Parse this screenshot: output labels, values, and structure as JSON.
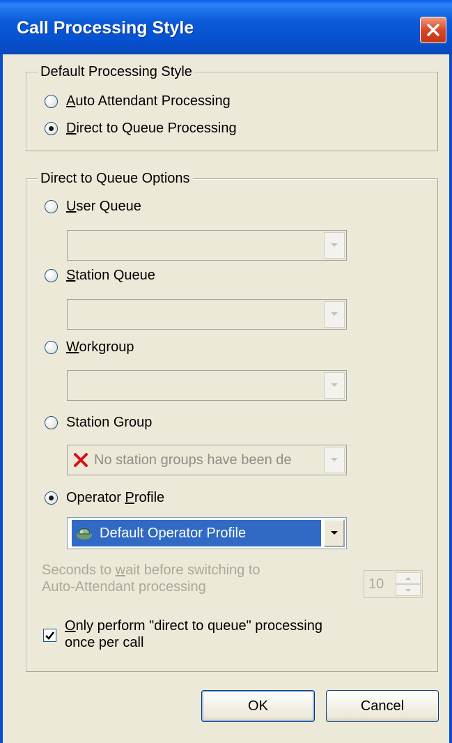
{
  "window": {
    "title": "Call Processing Style"
  },
  "default_style": {
    "legend": "Default Processing Style",
    "options": [
      {
        "pre": "",
        "key": "A",
        "post": "uto Attendant Processing",
        "checked": false
      },
      {
        "pre": "",
        "key": "D",
        "post": "irect to Queue Processing",
        "checked": true
      }
    ]
  },
  "queue_options": {
    "legend": "Direct to Queue Options",
    "user_queue": {
      "pre": "",
      "key": "U",
      "post": "ser Queue",
      "checked": false,
      "value": ""
    },
    "station_queue": {
      "pre": "",
      "key": "S",
      "post": "tation Queue",
      "checked": false,
      "value": ""
    },
    "workgroup": {
      "pre": "",
      "key": "W",
      "post": "orkgroup",
      "checked": false,
      "value": ""
    },
    "station_group": {
      "label": "Station Group",
      "checked": false,
      "value": "No station groups have been de",
      "icon": "error-x-icon"
    },
    "operator_profile": {
      "pre": "Operator ",
      "key": "P",
      "post": "rofile",
      "checked": true,
      "value": "Default Operator Profile",
      "icon": "operator-profile-icon"
    },
    "seconds": {
      "line1_pre": "Seconds to ",
      "line1_key": "w",
      "line1_post": "ait before switching to",
      "line2": "Auto-Attendant processing",
      "value": "10"
    },
    "once_per_call": {
      "line1_key": "O",
      "line1_post": "nly perform \"direct to queue\" processing",
      "line2": "once per call",
      "checked": true
    }
  },
  "buttons": {
    "ok": "OK",
    "cancel": "Cancel"
  },
  "colors": {
    "titlebar": "#0a5ad8",
    "dialog_bg": "#ece9d8",
    "selection": "#316ac5",
    "close": "#d9472a"
  }
}
